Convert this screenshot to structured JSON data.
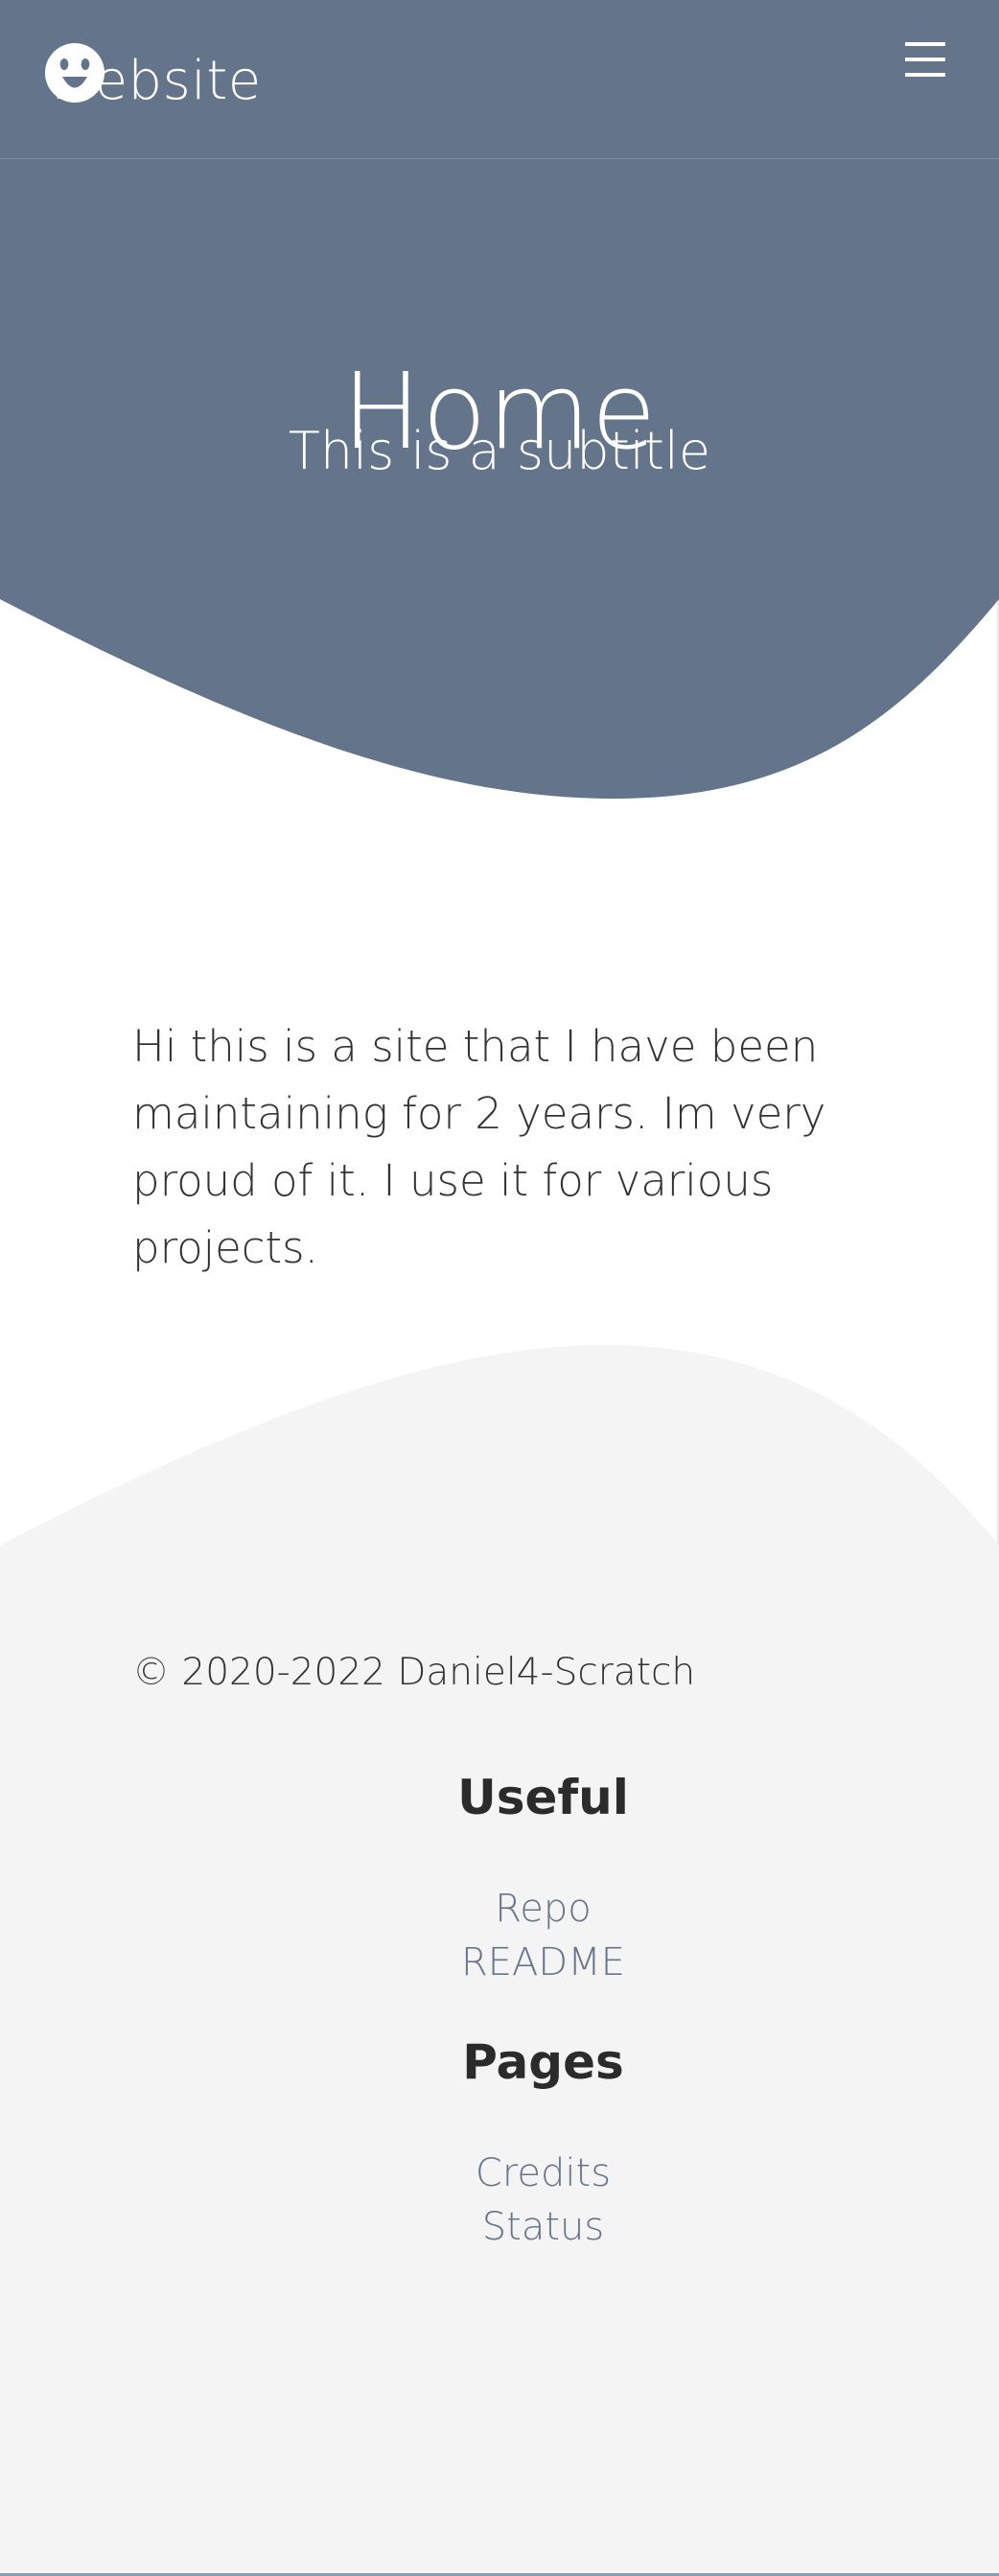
{
  "header": {
    "brand_name": "Website",
    "menu_label": "☰"
  },
  "hero": {
    "title": "Home",
    "subtitle": "This is a subtitle"
  },
  "main": {
    "intro": "Hi this is a site that I have been maintaining for 2 years. Im very proud of it. I use it for various projects."
  },
  "footer": {
    "copyright": "© 2020-2022 Daniel4-Scratch",
    "sections": [
      {
        "heading": "Useful",
        "links": [
          "Repo",
          "README"
        ]
      },
      {
        "heading": "Pages",
        "links": [
          "Credits",
          "Status"
        ]
      }
    ]
  },
  "colors": {
    "primary": "#64748B",
    "footer_bg": "#F4F4F4",
    "text": "#333333",
    "link": "#66758C"
  },
  "icons": {
    "logo": "smiley-face-icon",
    "menu": "hamburger-menu-icon"
  }
}
